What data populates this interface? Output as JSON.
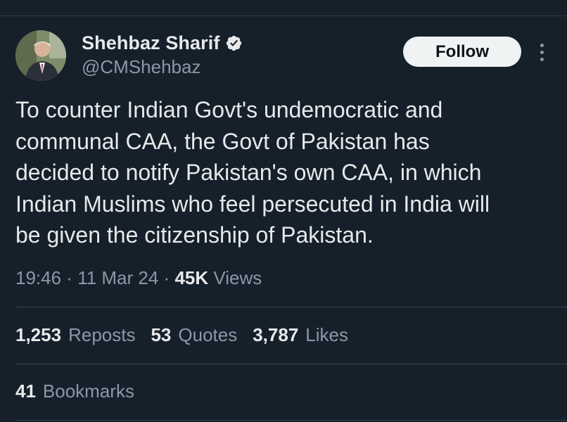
{
  "author": {
    "display_name": "Shehbaz Sharif",
    "handle": "@CMShehbaz",
    "verified": true
  },
  "follow_label": "Follow",
  "tweet": {
    "lines": [
      "To counter Indian Govt's undemocratic and",
      "communal CAA, the Govt of Pakistan has",
      "decided to notify Pakistan's own CAA, in which",
      "Indian Muslims who feel persecuted in India will",
      "be given the citizenship of Pakistan."
    ]
  },
  "meta": {
    "time": "19:46",
    "sep1": " · ",
    "date": "11 Mar 24",
    "sep2": " · ",
    "views_count": "45K",
    "views_label": "Views"
  },
  "stats": {
    "reposts_count": "1,253",
    "reposts_label": "Reposts",
    "quotes_count": "53",
    "quotes_label": "Quotes",
    "likes_count": "3,787",
    "likes_label": "Likes"
  },
  "bookmarks": {
    "count": "41",
    "label": "Bookmarks"
  },
  "colors": {
    "background": "#15202b",
    "text_primary": "#e7e9ea",
    "text_secondary": "#8b98a5",
    "verified_badge": "#e7e9ea",
    "follow_button_bg": "#eff3f4"
  },
  "icons": {
    "verified": "verified-badge-icon",
    "more": "more-options-icon"
  }
}
